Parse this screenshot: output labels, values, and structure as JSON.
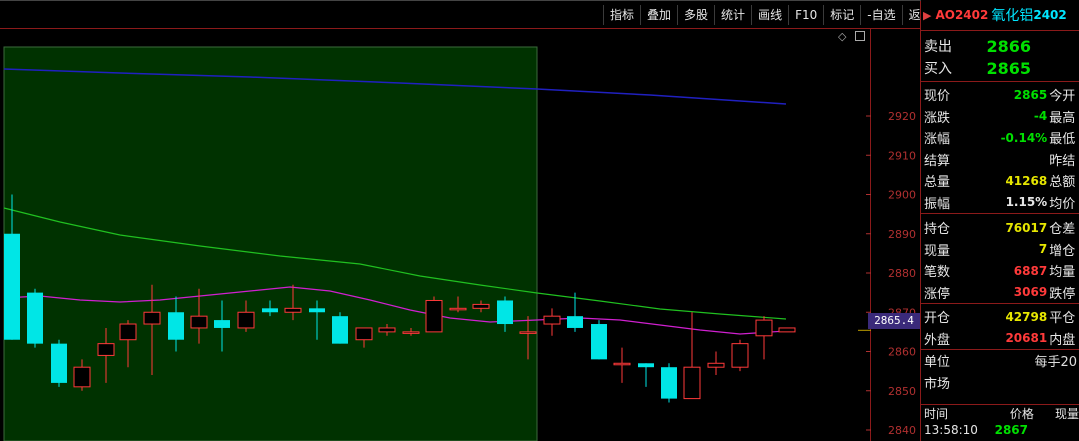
{
  "toolbar": [
    "指标",
    "叠加",
    "多股",
    "统计",
    "画线",
    "F10",
    "标记",
    "-自选",
    "返回"
  ],
  "price_axis": [
    "2920",
    "2910",
    "2900",
    "2890",
    "2880",
    "2870",
    "2860",
    "2850",
    "2840"
  ],
  "last_price_tag": "2865.4",
  "quote": {
    "code": "AO2402",
    "name": "氧化铝",
    "name_code": "2402",
    "sell_label": "卖出",
    "sell_value": "2866",
    "buy_label": "买入",
    "buy_value": "2865",
    "rows": [
      {
        "label": "现价",
        "value": "2865",
        "color": "#00e000",
        "label2": "今开"
      },
      {
        "label": "涨跌",
        "value": "-4",
        "color": "#00e000",
        "label2": "最高"
      },
      {
        "label": "涨幅",
        "value": "-0.14%",
        "color": "#00e000",
        "label2": "最低"
      },
      {
        "label": "结算",
        "value": "",
        "color": "#e6e6e6",
        "label2": "昨结"
      },
      {
        "label": "总量",
        "value": "41268",
        "color": "#e6e600",
        "label2": "总额"
      },
      {
        "label": "振幅",
        "value": "1.15%",
        "color": "#e6e6e6",
        "label2": "均价"
      }
    ],
    "rows2": [
      {
        "label": "持仓",
        "value": "76017",
        "color": "#e6e600",
        "label2": "仓差"
      },
      {
        "label": "现量",
        "value": "7",
        "color": "#e6e600",
        "label2": "增仓"
      },
      {
        "label": "笔数",
        "value": "6887",
        "color": "#ff3a3a",
        "label2": "均量"
      },
      {
        "label": "涨停",
        "value": "3069",
        "color": "#ff3a3a",
        "label2": "跌停"
      }
    ],
    "rows3": [
      {
        "label": "开仓",
        "value": "42798",
        "color": "#e6e600",
        "label2": "平仓"
      },
      {
        "label": "外盘",
        "value": "20681",
        "color": "#ff3a3a",
        "label2": "内盘"
      }
    ],
    "unit_label": "单位",
    "unit_value": "每手20",
    "market_label": "市场",
    "tick_header": {
      "time": "时间",
      "price": "价格",
      "vol": "现量"
    },
    "tick_row": {
      "time": "13:58:10",
      "price": "2867"
    }
  }
}
